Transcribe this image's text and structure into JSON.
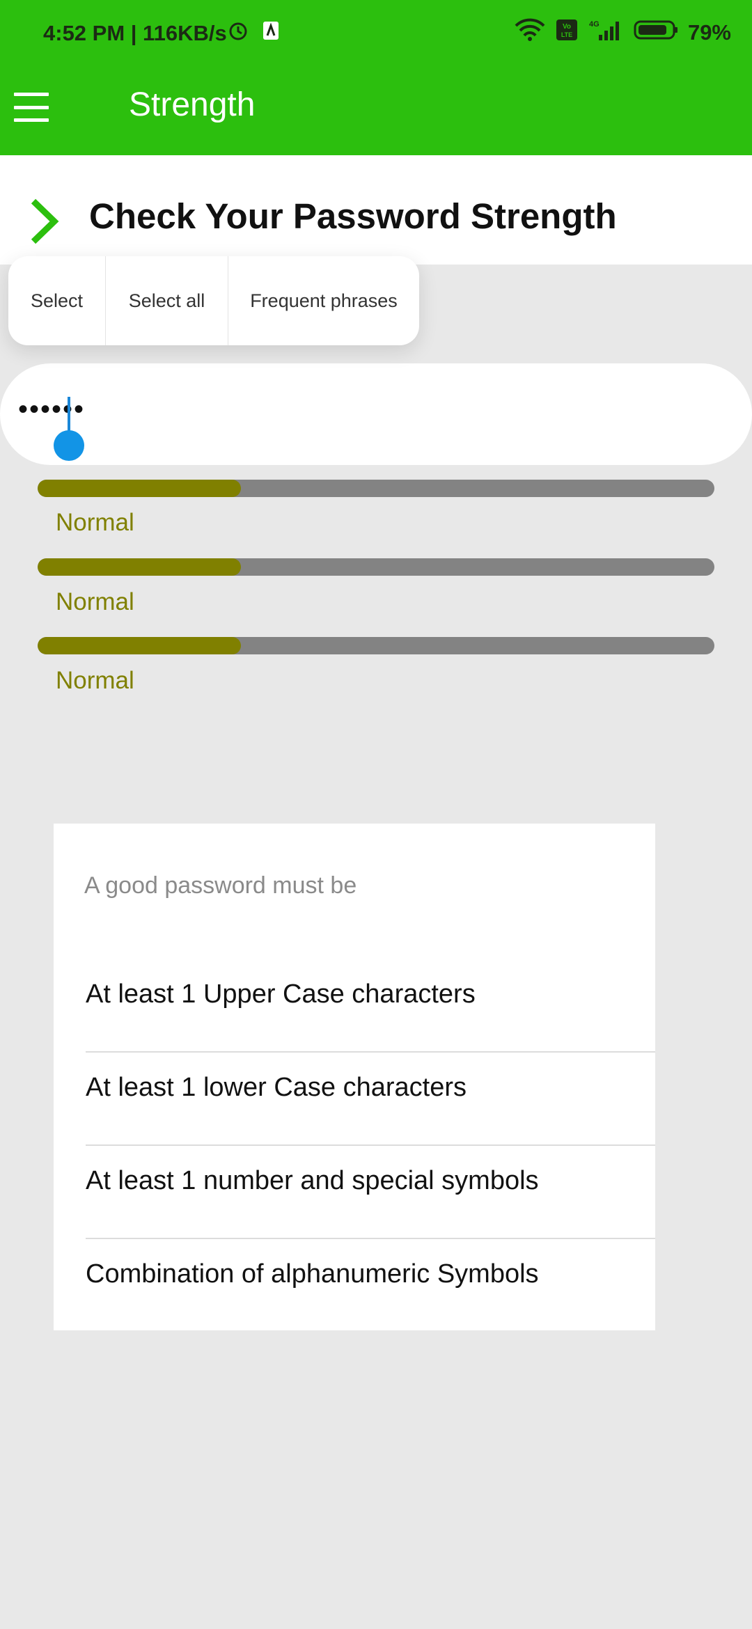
{
  "status_bar": {
    "time": "4:52 PM | 116KB/s",
    "battery": "79%",
    "icons": [
      "alarm-icon",
      "notification-icon",
      "wifi-icon",
      "volte-icon",
      "signal-icon",
      "battery-icon"
    ]
  },
  "app_bar": {
    "title": "Strength",
    "menu_icon": "hamburger-menu-icon",
    "color": "#2cbf0e"
  },
  "header": {
    "title": "Check Your Password Strength",
    "icon": "chevron-right-icon"
  },
  "context_menu": {
    "items": [
      {
        "label": "Select"
      },
      {
        "label": "Select all"
      },
      {
        "label": "Frequent phrases"
      }
    ]
  },
  "password_field": {
    "value": "••••••"
  },
  "strength_meters": [
    {
      "label": "Normal",
      "level": 0.3
    },
    {
      "label": "Normal",
      "level": 0.3
    },
    {
      "label": "Normal",
      "level": 0.3
    }
  ],
  "colors": {
    "meter_fill": "#808000",
    "meter_track": "#838383",
    "cursor": "#1294e6"
  },
  "rules": {
    "heading": "A good password must be",
    "items": [
      "At least 1 Upper Case characters",
      "At least 1 lower Case characters",
      "At least 1 number and special symbols",
      "Combination of alphanumeric Symbols"
    ]
  }
}
